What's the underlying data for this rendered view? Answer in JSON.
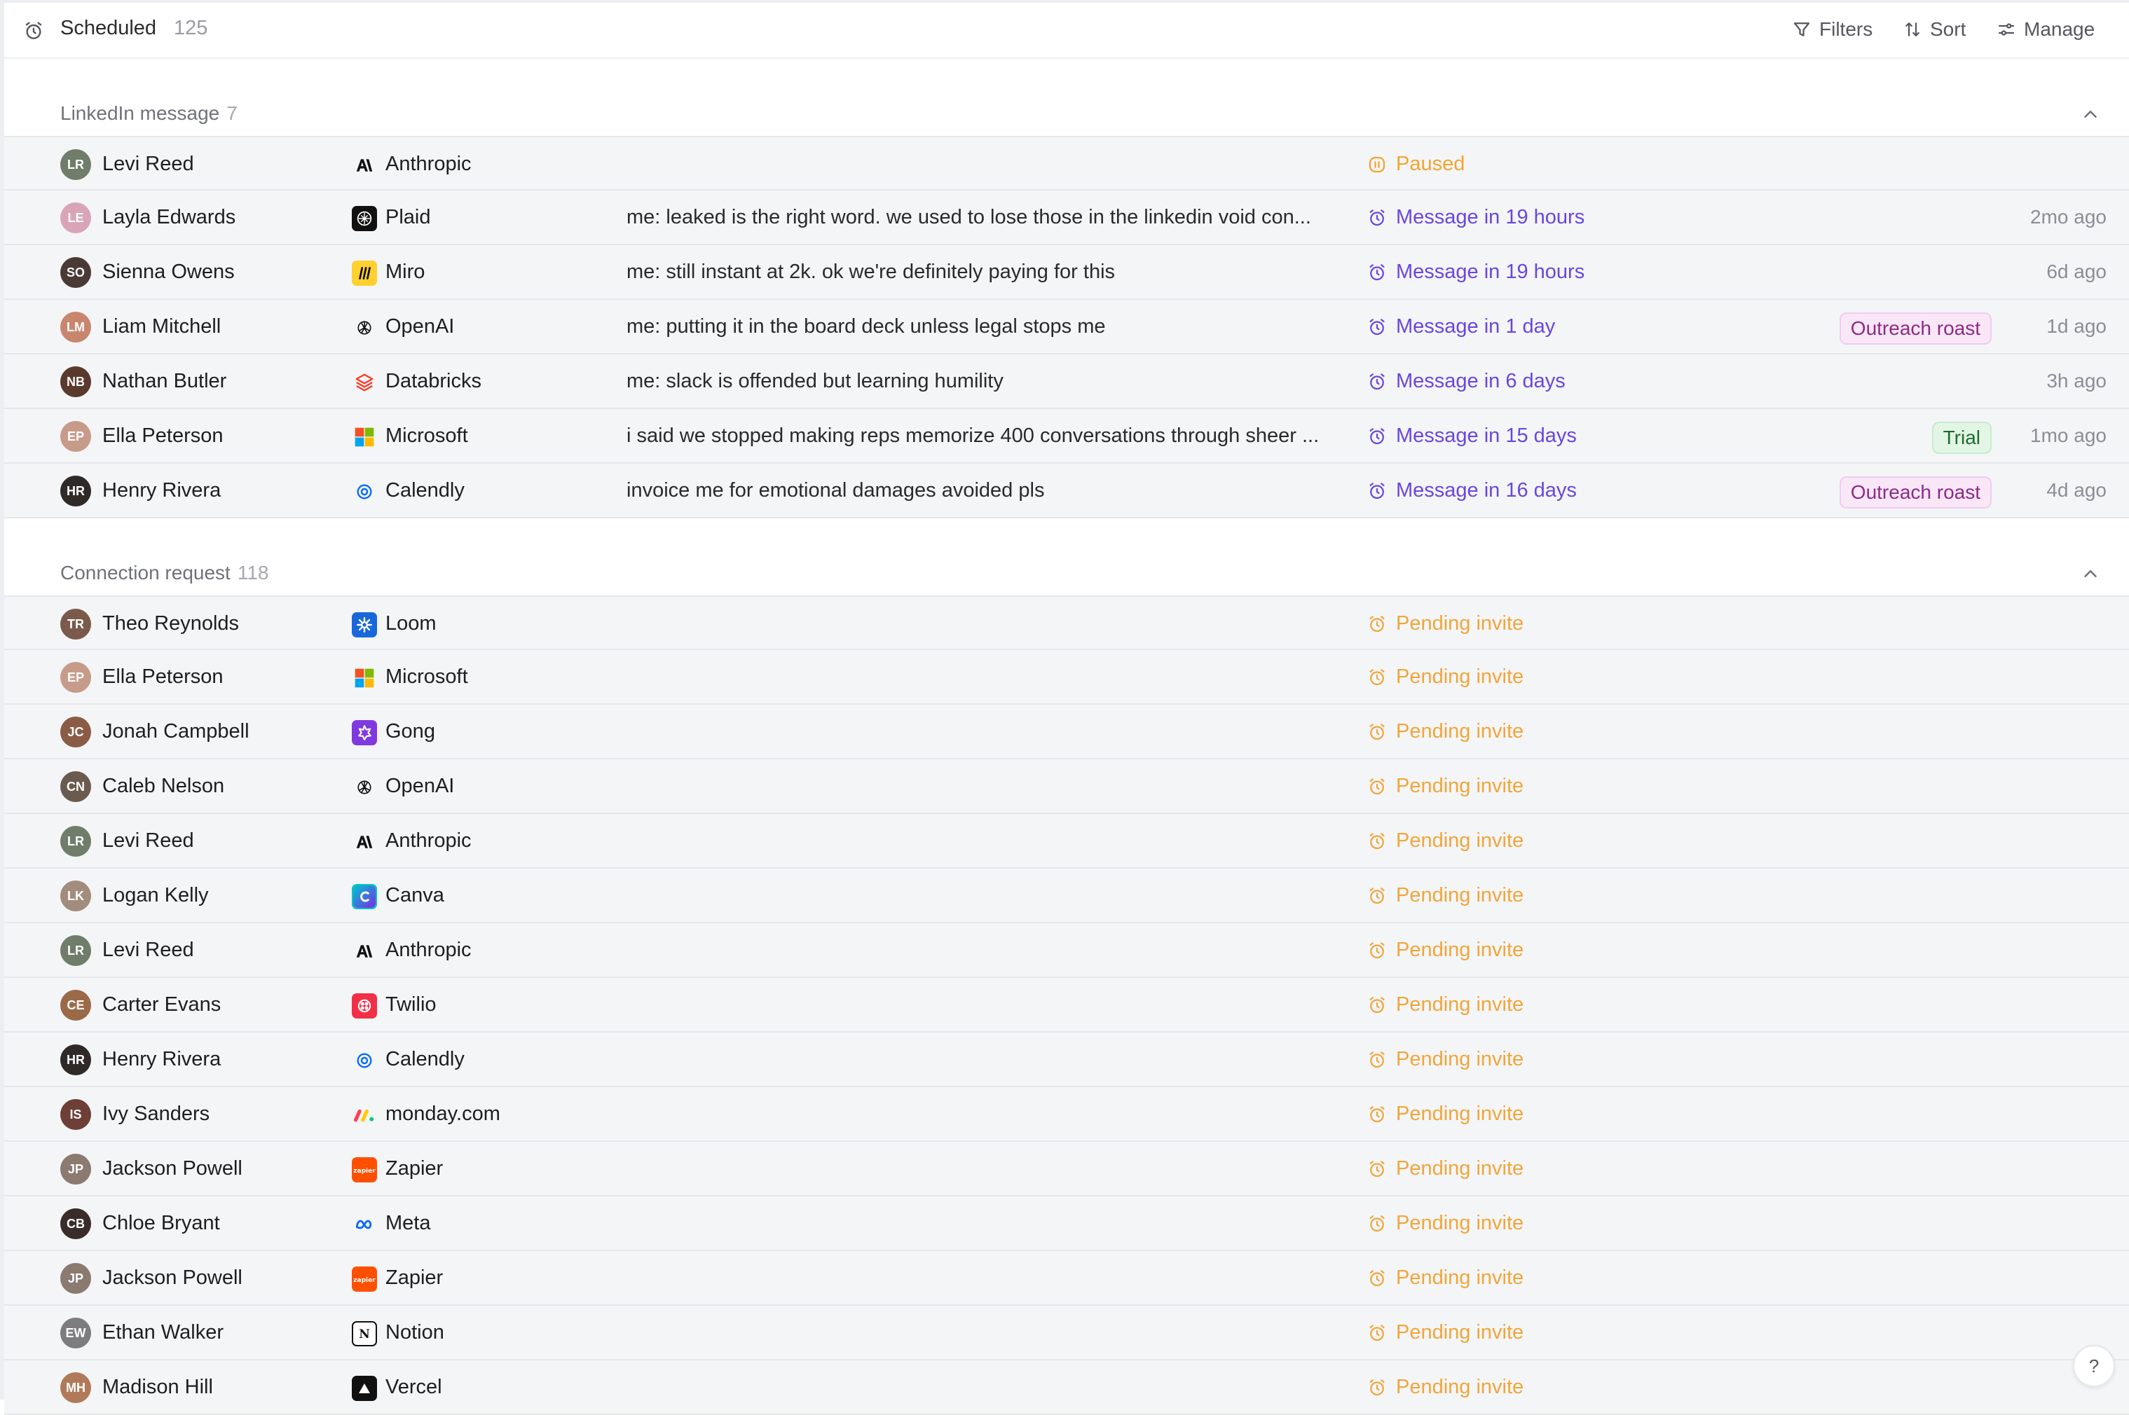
{
  "header": {
    "title": "Scheduled",
    "count": "125",
    "filters_label": "Filters",
    "sort_label": "Sort",
    "manage_label": "Manage"
  },
  "sections": [
    {
      "label": "LinkedIn message",
      "count": "7",
      "rows": [
        {
          "name": "Levi Reed",
          "avatar_color": "#6f7d6a",
          "initials": "LR",
          "company": "Anthropic",
          "logo": "anthropic",
          "message": "",
          "status": "Paused",
          "status_kind": "paused",
          "tag": "",
          "tag_kind": "",
          "time": ""
        },
        {
          "name": "Layla Edwards",
          "avatar_color": "#d9a5b6",
          "initials": "LE",
          "company": "Plaid",
          "logo": "plaid",
          "message": "me: leaked is the right word. we used to lose those in the linkedin void con...",
          "status": "Message in 19 hours",
          "status_kind": "message",
          "tag": "",
          "tag_kind": "",
          "time": "2mo ago"
        },
        {
          "name": "Sienna Owens",
          "avatar_color": "#4a3a35",
          "initials": "SO",
          "company": "Miro",
          "logo": "miro",
          "message": "me: still instant at 2k. ok we're definitely paying for this",
          "status": "Message in 19 hours",
          "status_kind": "message",
          "tag": "",
          "tag_kind": "",
          "time": "6d ago"
        },
        {
          "name": "Liam Mitchell",
          "avatar_color": "#c9866e",
          "initials": "LM",
          "company": "OpenAI",
          "logo": "openai",
          "message": "me: putting it in the board deck unless legal stops me",
          "status": "Message in 1 day",
          "status_kind": "message",
          "tag": "Outreach roast",
          "tag_kind": "roast",
          "time": "1d ago"
        },
        {
          "name": "Nathan Butler",
          "avatar_color": "#5b3a2e",
          "initials": "NB",
          "company": "Databricks",
          "logo": "databricks",
          "message": "me: slack is offended but learning humility",
          "status": "Message in 6 days",
          "status_kind": "message",
          "tag": "",
          "tag_kind": "",
          "time": "3h ago"
        },
        {
          "name": "Ella Peterson",
          "avatar_color": "#c79b8a",
          "initials": "EP",
          "company": "Microsoft",
          "logo": "microsoft",
          "message": "i said we stopped making reps memorize 400 conversations through sheer ...",
          "status": "Message in 15 days",
          "status_kind": "message",
          "tag": "Trial",
          "tag_kind": "trial",
          "time": "1mo ago"
        },
        {
          "name": "Henry Rivera",
          "avatar_color": "#2f2a28",
          "initials": "HR",
          "company": "Calendly",
          "logo": "calendly",
          "message": "invoice me for emotional damages avoided pls",
          "status": "Message in 16 days",
          "status_kind": "message",
          "tag": "Outreach roast",
          "tag_kind": "roast",
          "time": "4d ago"
        }
      ]
    },
    {
      "label": "Connection request",
      "count": "118",
      "rows": [
        {
          "name": "Theo Reynolds",
          "avatar_color": "#7a5a4a",
          "initials": "TR",
          "company": "Loom",
          "logo": "loom",
          "status": "Pending invite"
        },
        {
          "name": "Ella Peterson",
          "avatar_color": "#c79b8a",
          "initials": "EP",
          "company": "Microsoft",
          "logo": "microsoft",
          "status": "Pending invite"
        },
        {
          "name": "Jonah Campbell",
          "avatar_color": "#8a5c46",
          "initials": "JC",
          "company": "Gong",
          "logo": "gong",
          "status": "Pending invite"
        },
        {
          "name": "Caleb Nelson",
          "avatar_color": "#6b5a4e",
          "initials": "CN",
          "company": "OpenAI",
          "logo": "openai",
          "status": "Pending invite"
        },
        {
          "name": "Levi Reed",
          "avatar_color": "#6f7d6a",
          "initials": "LR",
          "company": "Anthropic",
          "logo": "anthropic",
          "status": "Pending invite"
        },
        {
          "name": "Logan Kelly",
          "avatar_color": "#a28c7c",
          "initials": "LK",
          "company": "Canva",
          "logo": "canva",
          "status": "Pending invite"
        },
        {
          "name": "Levi Reed",
          "avatar_color": "#6f7d6a",
          "initials": "LR",
          "company": "Anthropic",
          "logo": "anthropic",
          "status": "Pending invite"
        },
        {
          "name": "Carter Evans",
          "avatar_color": "#9a6a48",
          "initials": "CE",
          "company": "Twilio",
          "logo": "twilio",
          "status": "Pending invite"
        },
        {
          "name": "Henry Rivera",
          "avatar_color": "#2f2a28",
          "initials": "HR",
          "company": "Calendly",
          "logo": "calendly",
          "status": "Pending invite"
        },
        {
          "name": "Ivy Sanders",
          "avatar_color": "#6e3f37",
          "initials": "IS",
          "company": "monday.com",
          "logo": "monday",
          "status": "Pending invite"
        },
        {
          "name": "Jackson Powell",
          "avatar_color": "#8a7a70",
          "initials": "JP",
          "company": "Zapier",
          "logo": "zapier",
          "status": "Pending invite"
        },
        {
          "name": "Chloe Bryant",
          "avatar_color": "#3a2c2a",
          "initials": "CB",
          "company": "Meta",
          "logo": "meta",
          "status": "Pending invite"
        },
        {
          "name": "Jackson Powell",
          "avatar_color": "#8a7a70",
          "initials": "JP",
          "company": "Zapier",
          "logo": "zapier",
          "status": "Pending invite"
        },
        {
          "name": "Ethan Walker",
          "avatar_color": "#7d7d80",
          "initials": "EW",
          "company": "Notion",
          "logo": "notion",
          "status": "Pending invite"
        },
        {
          "name": "Madison Hill",
          "avatar_color": "#b07a5a",
          "initials": "MH",
          "company": "Vercel",
          "logo": "vercel",
          "status": "Pending invite"
        }
      ]
    }
  ],
  "help_label": "?"
}
